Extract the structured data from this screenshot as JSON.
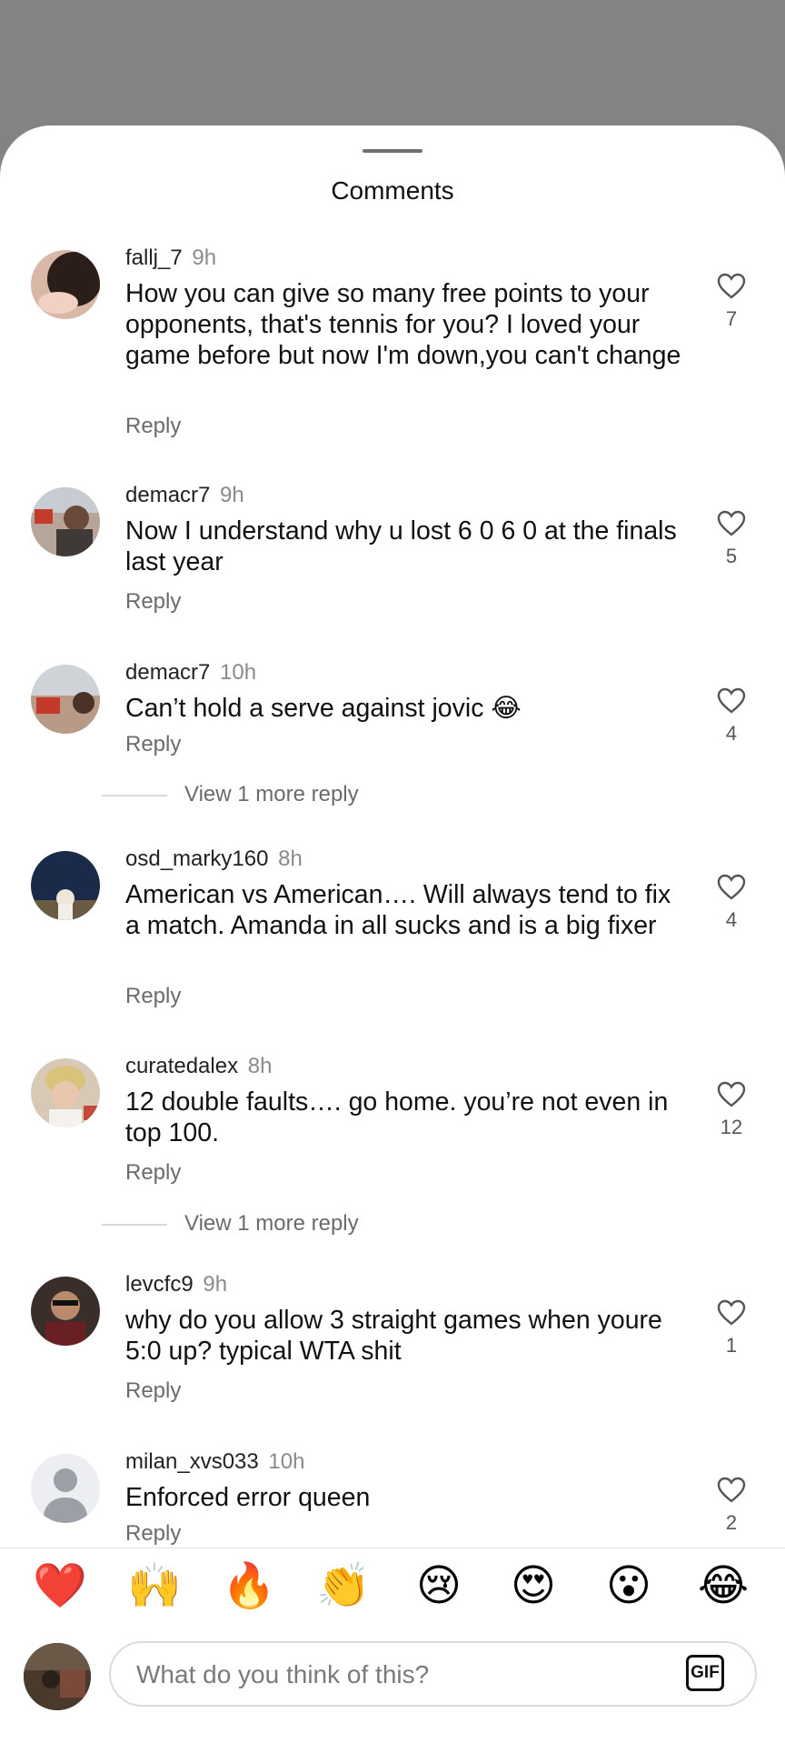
{
  "sheet": {
    "title": "Comments"
  },
  "comments": [
    {
      "username": "fallj_7",
      "time": "9h",
      "text": "How you can give so many free points to your opponents, that's tennis for you? I loved your game before but now I'm down,you can't change",
      "reply_label": "Reply",
      "likes": "7"
    },
    {
      "username": "demacr7",
      "time": "9h",
      "text": "Now I understand why u lost 6 0 6 0 at the finals last year",
      "reply_label": "Reply",
      "likes": "5"
    },
    {
      "username": "demacr7",
      "time": "10h",
      "text": "Can’t hold a serve against jovic 😂",
      "reply_label": "Reply",
      "likes": "4",
      "view_more": "View 1 more reply"
    },
    {
      "username": "osd_marky160",
      "time": "8h",
      "text": "American vs American…. Will always tend to fix a match. Amanda in all sucks and is a big fixer",
      "reply_label": "Reply",
      "likes": "4"
    },
    {
      "username": "curatedalex",
      "time": "8h",
      "text": "12 double faults…. go home. you’re not even in top 100.",
      "reply_label": "Reply",
      "likes": "12",
      "view_more": "View 1 more reply"
    },
    {
      "username": "levcfc9",
      "time": "9h",
      "text": "why do you allow 3 straight games when youre 5:0 up? typical WTA shit",
      "reply_label": "Reply",
      "likes": "1"
    },
    {
      "username": "milan_xvs033",
      "time": "10h",
      "text": "Enforced error queen",
      "reply_label": "Reply",
      "likes": "2"
    }
  ],
  "emoji_bar": [
    "❤️",
    "🙌",
    "🔥",
    "👏",
    "😢",
    "😍",
    "😮",
    "😂"
  ],
  "composer": {
    "placeholder": "What do you think of this?",
    "gif_label": "GIF"
  }
}
